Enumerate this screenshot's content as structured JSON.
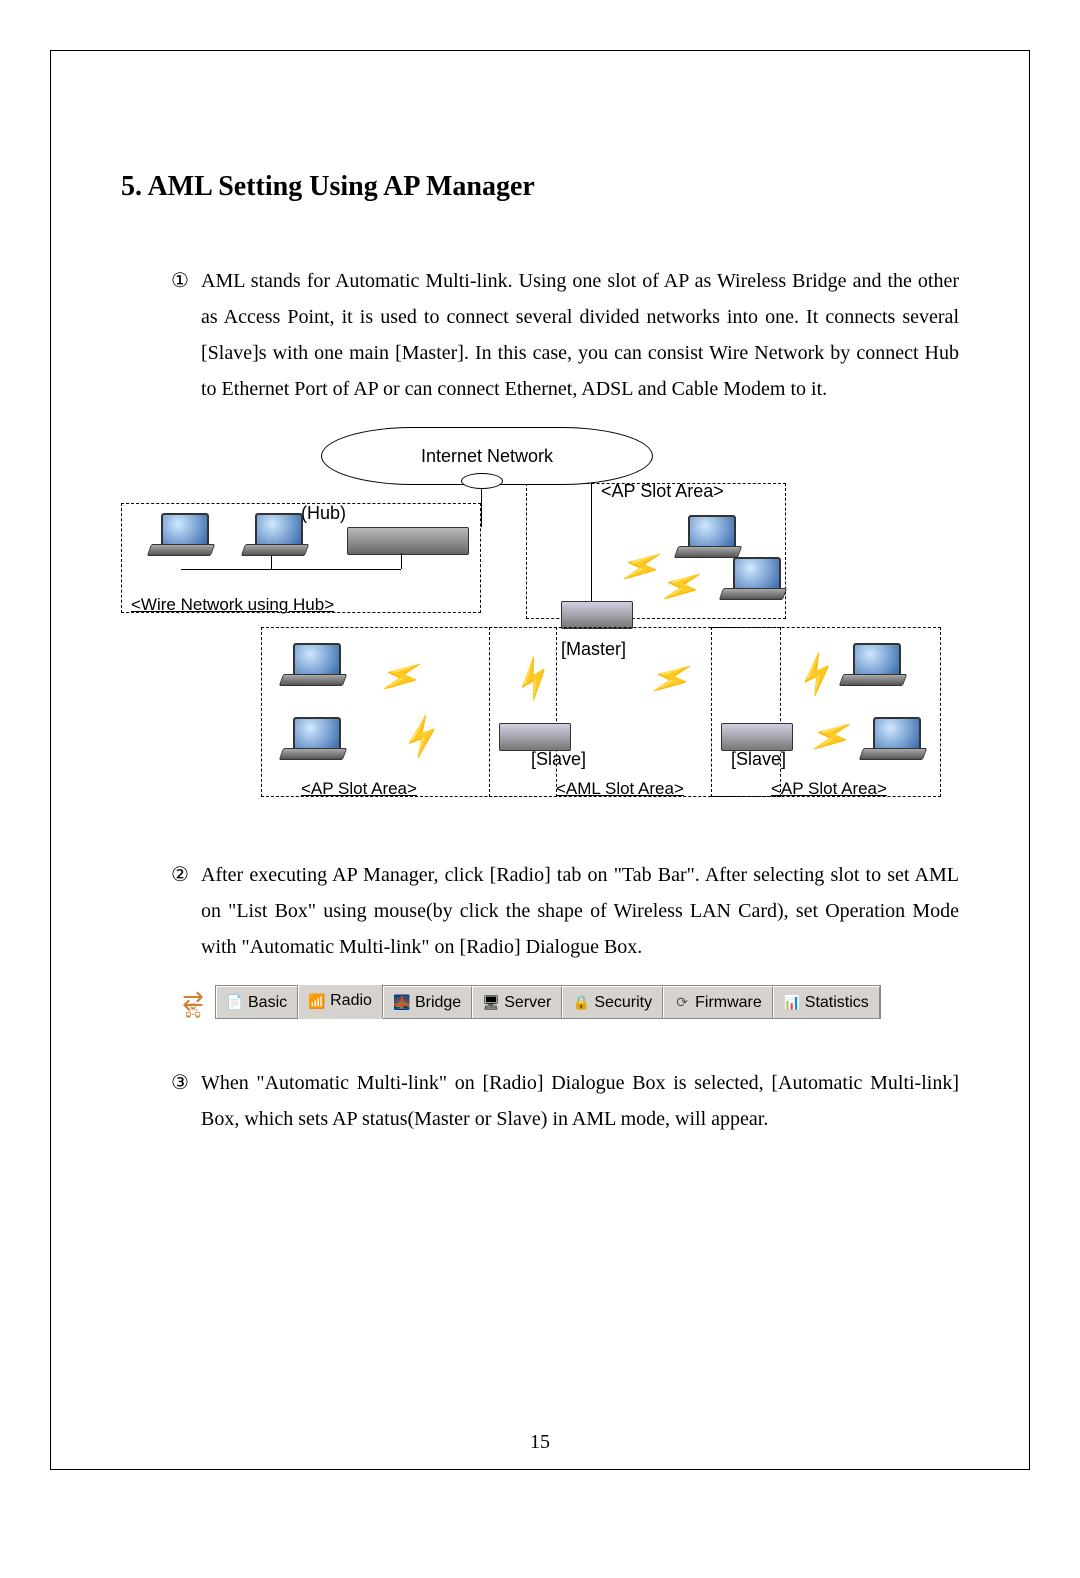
{
  "heading": "5.    AML Setting Using AP Manager",
  "list": {
    "item1_marker": "①",
    "item1_text": "AML stands for Automatic Multi-link. Using one slot of AP as Wireless Bridge and the other as Access Point, it is used to connect several divided networks into one. It connects several [Slave]s with one main [Master]. In this case, you can consist Wire Network by connect Hub to Ethernet Port of AP or can connect Ethernet, ADSL and Cable Modem to it.",
    "item2_marker": "②",
    "item2_text": "After executing AP Manager, click [Radio] tab on \"Tab Bar\". After selecting slot to set AML on \"List Box\" using mouse(by click the shape of Wireless LAN Card), set Operation Mode with \"Automatic Multi-link\" on [Radio] Dialogue Box.",
    "item3_marker": "③",
    "item3_text": "When \"Automatic Multi-link\" on [Radio] Dialogue Box is selected, [Automatic Multi-link] Box, which sets AP status(Master or Slave) in AML mode, will appear."
  },
  "diagram": {
    "internet": "Internet Network",
    "hub": "(Hub)",
    "ap_slot_area": "<AP Slot Area>",
    "wire_network": "<Wire Network using Hub>",
    "master": "[Master]",
    "slave": "[Slave]",
    "aml_slot_area": "<AML Slot Area>"
  },
  "tabs": {
    "basic": "Basic",
    "radio": "Radio",
    "bridge": "Bridge",
    "server": "Server",
    "security": "Security",
    "firmware": "Firmware",
    "statistics": "Statistics"
  },
  "page_number": "15"
}
